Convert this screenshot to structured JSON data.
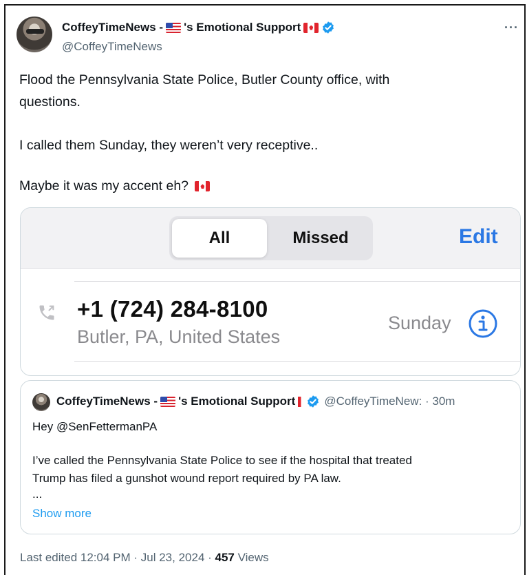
{
  "author": {
    "name_prefix": "CoffeyTimeNews - ",
    "name_suffix": "'s Emotional Support",
    "handle": "@CoffeyTimeNews"
  },
  "more_label": "···",
  "tweet_lines": [
    "Flood the Pennsylvania State Police, Butler County office, with",
    "questions.",
    "I called them Sunday, they weren’t very receptive..",
    "Maybe it was my accent eh?"
  ],
  "call_screenshot": {
    "tab_all": "All",
    "tab_missed": "Missed",
    "edit_label": "Edit",
    "phone_number": "+1 (724) 284-8100",
    "location": "Butler, PA, United States",
    "day": "Sunday"
  },
  "quoted_tweet": {
    "name_prefix": "CoffeyTimeNews - ",
    "name_suffix": "'s Emotional Support",
    "handle_time": "@CoffeyTimeNew: · 30m",
    "line1": "Hey @SenFettermanPA",
    "line2": "I’ve called the Pennsylvania State Police to see if the hospital that treated",
    "line3": "Trump has filed a gunshot wound report required by PA law.",
    "ellipsis": "...",
    "show_more": "Show more"
  },
  "footer": {
    "edited": "Last edited 12:04 PM · Jul 23, 2024 · ",
    "views_count": "457",
    "views_label": " Views"
  },
  "colors": {
    "link_blue": "#1d9bf0",
    "ios_blue": "#2b78e4",
    "verified_blue": "#1d9bf0"
  }
}
